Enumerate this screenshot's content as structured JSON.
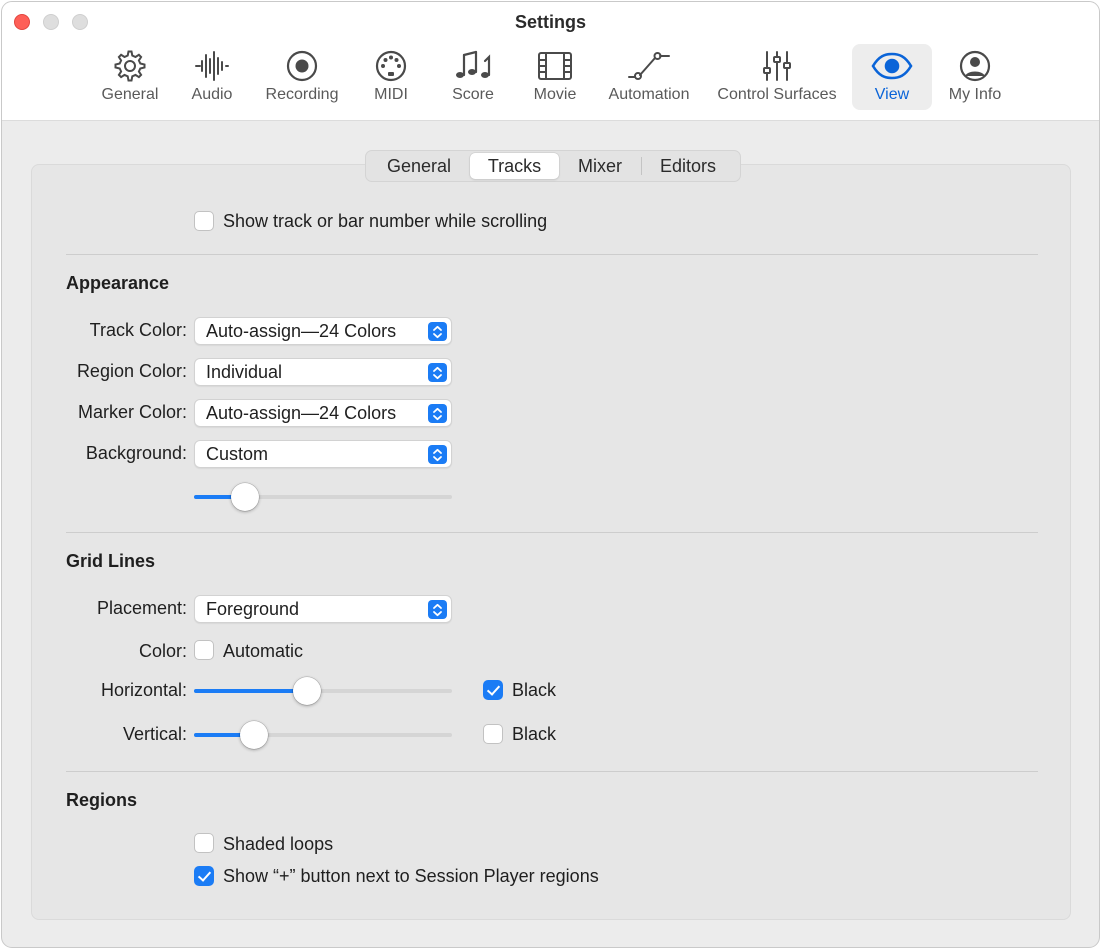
{
  "window": {
    "title": "Settings"
  },
  "toolbar": {
    "items": [
      {
        "label": "General",
        "icon": "gear-icon"
      },
      {
        "label": "Audio",
        "icon": "waveform-icon"
      },
      {
        "label": "Recording",
        "icon": "record-icon"
      },
      {
        "label": "MIDI",
        "icon": "midi-port-icon"
      },
      {
        "label": "Score",
        "icon": "music-notes-icon"
      },
      {
        "label": "Movie",
        "icon": "film-icon"
      },
      {
        "label": "Automation",
        "icon": "automation-curve-icon"
      },
      {
        "label": "Control Surfaces",
        "icon": "faders-icon"
      },
      {
        "label": "View",
        "icon": "eye-icon",
        "selected": true
      },
      {
        "label": "My Info",
        "icon": "person-icon"
      }
    ]
  },
  "tabs": {
    "items": [
      "General",
      "Tracks",
      "Mixer",
      "Editors"
    ],
    "active": "Tracks"
  },
  "options": {
    "show_track_number": {
      "label": "Show track or bar number while scrolling",
      "checked": false
    }
  },
  "appearance": {
    "title": "Appearance",
    "track_color": {
      "label": "Track Color:",
      "value": "Auto-assign—24 Colors"
    },
    "region_color": {
      "label": "Region Color:",
      "value": "Individual"
    },
    "marker_color": {
      "label": "Marker Color:",
      "value": "Auto-assign—24 Colors"
    },
    "background": {
      "label": "Background:",
      "value": "Custom",
      "slider_fraction": 0.16
    }
  },
  "grid_lines": {
    "title": "Grid Lines",
    "placement": {
      "label": "Placement:",
      "value": "Foreground"
    },
    "color": {
      "label": "Color:",
      "checkbox_label": "Automatic",
      "checked": false
    },
    "horizontal": {
      "label": "Horizontal:",
      "slider_fraction": 0.43,
      "black_label": "Black",
      "black_checked": true
    },
    "vertical": {
      "label": "Vertical:",
      "slider_fraction": 0.2,
      "black_label": "Black",
      "black_checked": false
    }
  },
  "regions": {
    "title": "Regions",
    "shaded_loops": {
      "label": "Shaded loops",
      "checked": false
    },
    "show_plus_button": {
      "label": "Show “+” button next to Session Player regions",
      "checked": true
    }
  },
  "colors": {
    "accent": "#1b7cf5",
    "close": "#fe5f57",
    "selected_label": "#0a64d8"
  }
}
